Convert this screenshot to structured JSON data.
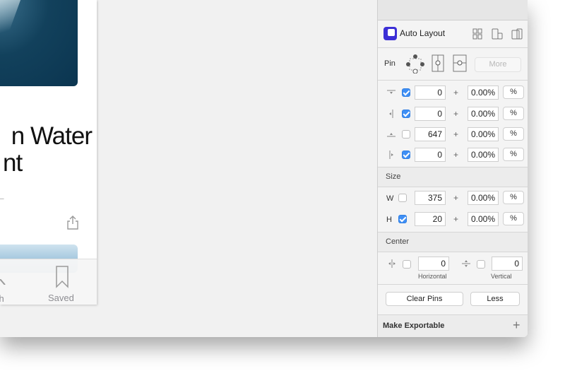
{
  "canvas": {
    "headline_line1": "n Water",
    "headline_line2": "nt",
    "tabs": [
      {
        "label": "ch",
        "icon": "search-icon"
      },
      {
        "label": "Saved",
        "icon": "bookmark-icon"
      }
    ]
  },
  "inspector": {
    "auto_layout_title": "Auto Layout",
    "pin_label": "Pin",
    "more_label": "More",
    "pin_rows": [
      {
        "edge": "top",
        "checked": true,
        "value": "0",
        "plus": "+",
        "percent": "0.00%",
        "unit": "%"
      },
      {
        "edge": "left",
        "checked": true,
        "value": "0",
        "plus": "+",
        "percent": "0.00%",
        "unit": "%"
      },
      {
        "edge": "bottom",
        "checked": false,
        "value": "647",
        "plus": "+",
        "percent": "0.00%",
        "unit": "%"
      },
      {
        "edge": "right",
        "checked": true,
        "value": "0",
        "plus": "+",
        "percent": "0.00%",
        "unit": "%"
      }
    ],
    "size": {
      "header": "Size",
      "rows": [
        {
          "label": "W",
          "checked": false,
          "value": "375",
          "plus": "+",
          "percent": "0.00%",
          "unit": "%"
        },
        {
          "label": "H",
          "checked": true,
          "value": "20",
          "plus": "+",
          "percent": "0.00%",
          "unit": "%"
        }
      ]
    },
    "center": {
      "header": "Center",
      "horizontal": {
        "checked": false,
        "value": "0",
        "label": "Horizontal"
      },
      "vertical": {
        "checked": false,
        "value": "0",
        "label": "Vertical"
      }
    },
    "buttons": {
      "clear_pins": "Clear Pins",
      "less": "Less"
    },
    "export": {
      "label": "Make Exportable",
      "plus": "+"
    }
  },
  "colors": {
    "accent": "#3f8ff5",
    "logo": "#3c2fd6"
  }
}
